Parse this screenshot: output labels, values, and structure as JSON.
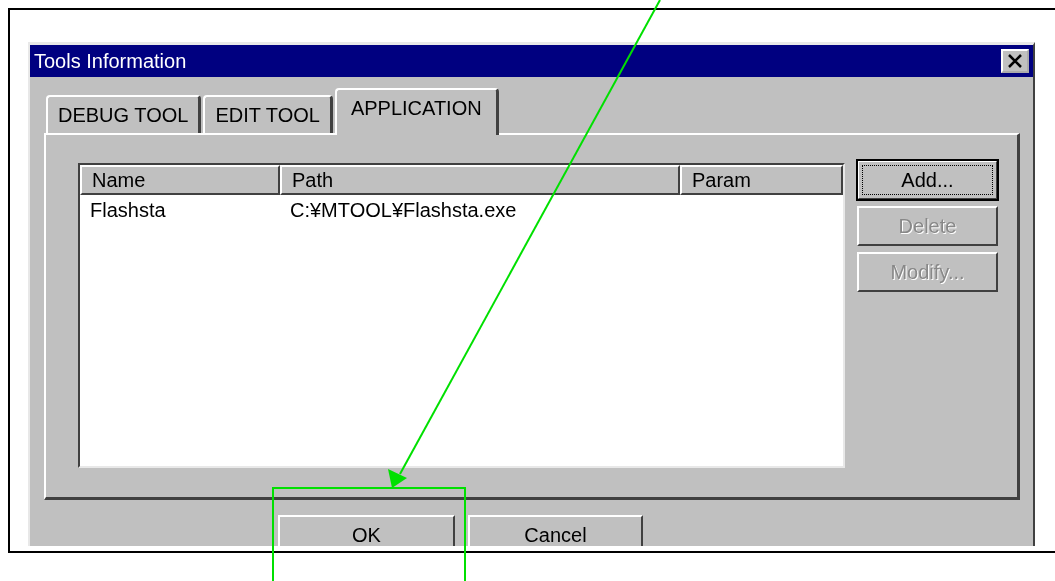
{
  "window": {
    "title": "Tools Information"
  },
  "tabs": [
    {
      "label": "DEBUG TOOL",
      "selected": false
    },
    {
      "label": "EDIT TOOL",
      "selected": false
    },
    {
      "label": "APPLICATION",
      "selected": true
    }
  ],
  "table": {
    "columns": [
      "Name",
      "Path",
      "Param"
    ],
    "rows": [
      [
        "Flashsta",
        "C:¥MTOOL¥Flashsta.exe",
        ""
      ]
    ]
  },
  "side_buttons": [
    {
      "label": "Add...",
      "disabled": false,
      "focused": true
    },
    {
      "label": "Delete",
      "disabled": true,
      "focused": false
    },
    {
      "label": "Modify...",
      "disabled": true,
      "focused": false
    }
  ],
  "buttons": [
    "OK",
    "Cancel"
  ]
}
